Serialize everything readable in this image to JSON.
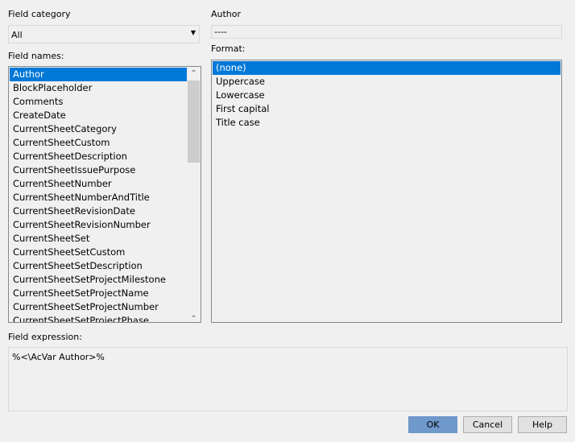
{
  "field_category": {
    "label": "Field category",
    "value": "All"
  },
  "field_names": {
    "label": "Field names:",
    "items": [
      "Author",
      "BlockPlaceholder",
      "Comments",
      "CreateDate",
      "CurrentSheetCategory",
      "CurrentSheetCustom",
      "CurrentSheetDescription",
      "CurrentSheetIssuePurpose",
      "CurrentSheetNumber",
      "CurrentSheetNumberAndTitle",
      "CurrentSheetRevisionDate",
      "CurrentSheetRevisionNumber",
      "CurrentSheetSet",
      "CurrentSheetSetCustom",
      "CurrentSheetSetDescription",
      "CurrentSheetSetProjectMilestone",
      "CurrentSheetSetProjectName",
      "CurrentSheetSetProjectNumber",
      "CurrentSheetSetProjectPhase"
    ],
    "selected": "Author"
  },
  "value": {
    "label": "Author",
    "value": "----"
  },
  "format": {
    "label": "Format:",
    "items": [
      "(none)",
      "Uppercase",
      "Lowercase",
      "First capital",
      "Title case"
    ],
    "selected": "(none)"
  },
  "expression": {
    "label": "Field expression:",
    "value": "%<\\AcVar Author>%"
  },
  "buttons": {
    "ok": "OK",
    "cancel": "Cancel",
    "help": "Help"
  },
  "colors": {
    "selection": "#0078d7",
    "ok_button": "#6f98cb"
  }
}
